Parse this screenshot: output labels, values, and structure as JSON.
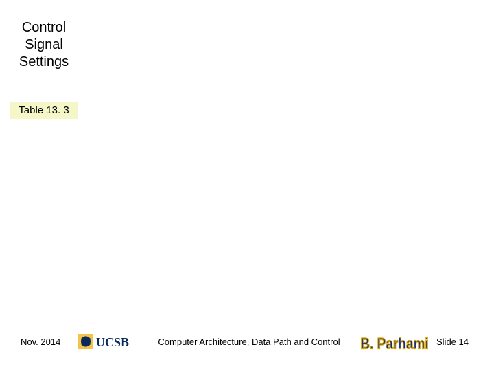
{
  "title_line1": "Control",
  "title_line2": "Signal",
  "title_line3": "Settings",
  "table_caption": "Table 13. 3",
  "footer": {
    "date": "Nov. 2014",
    "course_title": "Computer Architecture, Data Path and Control",
    "slide_label": "Slide 14"
  },
  "logos": {
    "ucsb_alt": "UCSB",
    "author_alt": "B. Parhami"
  },
  "colors": {
    "caption_bg": "#f5f7c8",
    "ucsb_navy": "#0a2a5c",
    "ucsb_gold": "#f3c34a",
    "author_name_fill": "#0a2a9c",
    "author_name_stroke": "#d4a000"
  }
}
